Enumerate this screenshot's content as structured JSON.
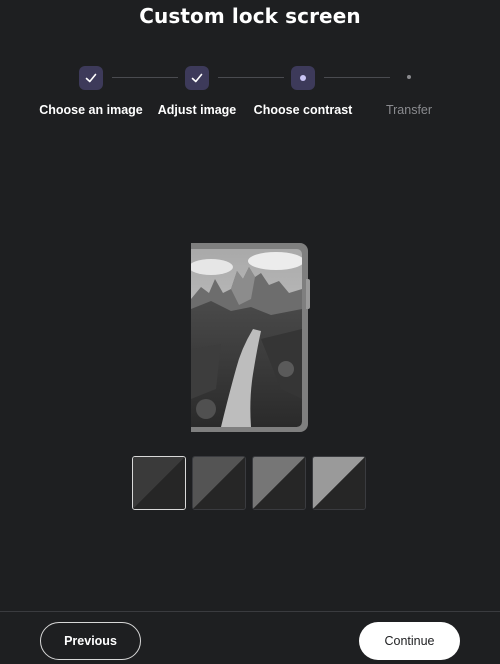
{
  "header": {
    "title": "Custom lock screen"
  },
  "stepper": {
    "steps": [
      {
        "label": "Choose an image",
        "status": "completed",
        "icon": "check-icon"
      },
      {
        "label": "Adjust image",
        "status": "completed",
        "icon": "check-icon"
      },
      {
        "label": "Choose contrast",
        "status": "current",
        "icon": "dot-icon"
      },
      {
        "label": "Transfer",
        "status": "upcoming",
        "icon": "dot-icon"
      }
    ]
  },
  "preview": {
    "image": "mountain-trail-photo-grayscale"
  },
  "contrast": {
    "selected_index": 0,
    "options": [
      {
        "light": "#3a3a3a",
        "dark": "#262626"
      },
      {
        "light": "#545454",
        "dark": "#262626"
      },
      {
        "light": "#767676",
        "dark": "#262626"
      },
      {
        "light": "#9a9a9a",
        "dark": "#262626"
      }
    ]
  },
  "footer": {
    "previous_label": "Previous",
    "continue_label": "Continue"
  },
  "colors": {
    "background": "#1e1f21",
    "accent": "#3d3a5a",
    "accent_dot": "#c9c4f5"
  }
}
